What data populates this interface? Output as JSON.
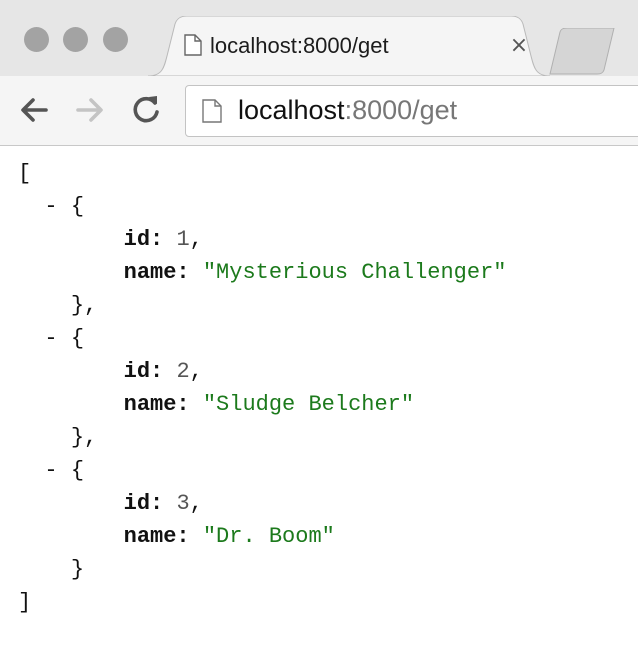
{
  "tab": {
    "title": "localhost:8000/get",
    "close_glyph": "×"
  },
  "address_bar": {
    "host": "localhost",
    "rest": ":8000/get"
  },
  "icons": [
    "page-icon",
    "close-icon",
    "back-icon",
    "forward-icon",
    "reload-icon"
  ],
  "json_view": {
    "open_bracket": "[",
    "close_bracket": "]",
    "toggle": "-",
    "open_brace": "{",
    "close_brace_comma": "},",
    "close_brace": "}",
    "id_key": "id:",
    "name_key": "name:",
    "items": [
      {
        "id": "1",
        "name": "\"Mysterious Challenger\""
      },
      {
        "id": "2",
        "name": "\"Sludge Belcher\""
      },
      {
        "id": "3",
        "name": "\"Dr. Boom\""
      }
    ]
  },
  "colors": {
    "string": "#1c7a1c",
    "number": "#555555",
    "chrome": "#e8e8e8"
  }
}
